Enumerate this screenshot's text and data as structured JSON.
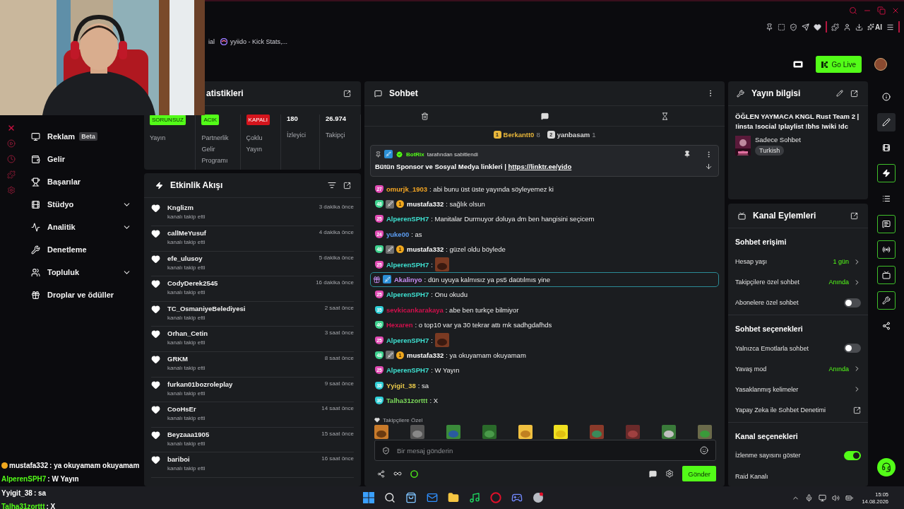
{
  "window_controls": [
    {
      "kind": "search"
    },
    {
      "kind": "minimize"
    },
    {
      "kind": "restore"
    },
    {
      "kind": "close"
    }
  ],
  "toolbar": [
    {
      "kind": "pin"
    },
    {
      "kind": "select"
    },
    {
      "kind": "shield"
    },
    {
      "kind": "send"
    },
    {
      "kind": "heart"
    },
    {
      "kind": "divider"
    },
    {
      "kind": "puzzle"
    },
    {
      "kind": "user"
    },
    {
      "kind": "download"
    },
    {
      "kind": "ai",
      "label": "AI"
    },
    {
      "kind": "menu"
    },
    {
      "kind": "divider"
    }
  ],
  "bookmarks": [
    {
      "kind": "text",
      "label": "ial"
    },
    {
      "kind": "site",
      "label": "yyiido - Kick Stats,..."
    }
  ],
  "header": {
    "go_live": "Go Live"
  },
  "sidebar": {
    "rail": [
      {
        "kind": "x"
      },
      {
        "kind": "play"
      },
      {
        "kind": "clock"
      },
      {
        "kind": "puzzle"
      },
      {
        "kind": "gear"
      }
    ],
    "items": [
      {
        "kind": "ad",
        "label": "Reklam",
        "badge": "Beta",
        "expandable": false
      },
      {
        "kind": "revenue",
        "label": "Gelir",
        "expandable": false
      },
      {
        "kind": "trophy",
        "label": "Başarılar",
        "expandable": false
      },
      {
        "kind": "studio",
        "label": "Stüdyo",
        "expandable": true
      },
      {
        "kind": "analytics",
        "label": "Analitik",
        "expandable": true
      },
      {
        "kind": "wrench",
        "label": "Denetleme",
        "expandable": false
      },
      {
        "kind": "community",
        "label": "Topluluk",
        "expandable": true
      },
      {
        "kind": "drops",
        "label": "Droplar ve ödüller",
        "expandable": false
      }
    ]
  },
  "stats": {
    "title": "atistikleri",
    "cells": [
      {
        "kind": "badge",
        "badge": "SORUNSUZ",
        "color": "#53fc18",
        "label": "Yayın"
      },
      {
        "kind": "badge",
        "badge": "ACIK",
        "color": "#53fc18",
        "label": "Partnerlik Gelir Programı"
      },
      {
        "kind": "badge",
        "badge": "KAPALI",
        "color": "#d4141c",
        "label": "Çoklu Yayın"
      },
      {
        "kind": "value",
        "value": "180",
        "label": "İzleyici"
      },
      {
        "kind": "value",
        "value": "26.974",
        "label": "Takipçi"
      }
    ]
  },
  "activity": {
    "title": "Etkinlik Akışı",
    "events": [
      {
        "user": "Knglizm",
        "action": "kanalı takip etti",
        "time": "3 dakika önce"
      },
      {
        "user": "callMeYusuf",
        "action": "kanalı takip etti",
        "time": "4 dakika önce"
      },
      {
        "user": "efe_ulusoy",
        "action": "kanalı takip etti",
        "time": "5 dakika önce"
      },
      {
        "user": "CodyDerek2545",
        "action": "kanalı takip etti",
        "time": "16 dakika önce"
      },
      {
        "user": "TC_OsmaniyeBelediyesi",
        "action": "kanalı takip etti",
        "time": "2 saat önce"
      },
      {
        "user": "Orhan_Cetin",
        "action": "kanalı takip etti",
        "time": "3 saat önce"
      },
      {
        "user": "GRKM",
        "action": "kanalı takip etti",
        "time": "8 saat önce"
      },
      {
        "user": "furkan01bozroleplay",
        "action": "kanalı takip etti",
        "time": "9 saat önce"
      },
      {
        "user": "CooHsEr",
        "action": "kanalı takip etti",
        "time": "14 saat önce"
      },
      {
        "user": "Beyzaaa1905",
        "action": "kanalı takip etti",
        "time": "15 saat önce"
      },
      {
        "user": "bariboi",
        "action": "kanalı takip etti",
        "time": "16 saat önce"
      }
    ]
  },
  "chat": {
    "title": "Sohbet",
    "leaders": [
      {
        "rank": "1",
        "name": "Berkantt0",
        "count": "8",
        "color": "#e8b63a"
      },
      {
        "rank": "2",
        "name": "yanbasam",
        "count": "1",
        "color": "#d8d8d8"
      }
    ],
    "pinned": {
      "by": "BotRix",
      "suffix": "tarafından sabitlendi",
      "text": "Bütün Sponsor ve Sosyal Medya linkleri |",
      "link": "https://linktr.ee/yido"
    },
    "messages": [
      {
        "badges": [
          {
            "kind": "sub",
            "label": "27",
            "color": "#e24bb4"
          }
        ],
        "user": "omurjk_1903",
        "color": "#f5a623",
        "text": ": abi bunu üst üste yayında söyleyemez ki",
        "emote": false,
        "highlighted": false
      },
      {
        "badges": [
          {
            "kind": "sub",
            "label": "48",
            "color": "#3fd28f"
          },
          {
            "kind": "mod",
            "color": "#6e6e6e"
          },
          {
            "kind": "count",
            "label": "1"
          }
        ],
        "user": "mustafa332",
        "color": "#ffffff",
        "text": ": sağlık olsun",
        "emote": false,
        "highlighted": false
      },
      {
        "badges": [
          {
            "kind": "sub",
            "label": "25",
            "color": "#e24bb4"
          }
        ],
        "user": "AlperenSPH7",
        "color": "#3ee0d0",
        "text": ": Manitalar Durmuyor doluya dm ben hangisini seçicem",
        "emote": false,
        "highlighted": false
      },
      {
        "badges": [
          {
            "kind": "sub",
            "label": "24",
            "color": "#e24bb4"
          }
        ],
        "user": "yuke00",
        "color": "#5b9cf0",
        "text": ": as",
        "emote": false,
        "highlighted": false
      },
      {
        "badges": [
          {
            "kind": "sub",
            "label": "48",
            "color": "#3fd28f"
          },
          {
            "kind": "mod",
            "color": "#6e6e6e"
          },
          {
            "kind": "count",
            "label": "1"
          }
        ],
        "user": "mustafa332",
        "color": "#ffffff",
        "text": ": güzel oldu böylede",
        "emote": false,
        "highlighted": false
      },
      {
        "badges": [
          {
            "kind": "sub",
            "label": "25",
            "color": "#e24bb4"
          }
        ],
        "user": "AlperenSPH7",
        "color": "#3ee0d0",
        "text": ":",
        "emote": true,
        "highlighted": false
      },
      {
        "badges": [
          {
            "kind": "gift"
          },
          {
            "kind": "mod",
            "color": "#2b8fd6"
          }
        ],
        "user": "Akalinyo",
        "color": "#c88ef5",
        "text": ": dün uyuya kalmısız ya ps5 daütılmıs yine",
        "emote": false,
        "highlighted": true
      },
      {
        "badges": [
          {
            "kind": "sub",
            "label": "25",
            "color": "#e24bb4"
          }
        ],
        "user": "AlperenSPH7",
        "color": "#3ee0d0",
        "text": ": Onu okudu",
        "emote": false,
        "highlighted": false
      },
      {
        "badges": [
          {
            "kind": "sub",
            "label": "35",
            "color": "#2fd0d8"
          }
        ],
        "user": "sevkicankarakaya",
        "color": "#d0104c",
        "text": ": abe ben turkçe bilmiyor",
        "emote": false,
        "highlighted": false
      },
      {
        "badges": [
          {
            "kind": "sub",
            "label": "40",
            "color": "#3fd28f"
          }
        ],
        "user": "Hexaren",
        "color": "#d0104c",
        "text": ": o top10 var ya 30 tekrar attı mk sadhgdafhds",
        "emote": false,
        "highlighted": false
      },
      {
        "badges": [
          {
            "kind": "sub",
            "label": "25",
            "color": "#e24bb4"
          }
        ],
        "user": "AlperenSPH7",
        "color": "#3ee0d0",
        "text": ":",
        "emote": true,
        "highlighted": false
      },
      {
        "badges": [
          {
            "kind": "sub",
            "label": "48",
            "color": "#3fd28f"
          },
          {
            "kind": "mod",
            "color": "#6e6e6e"
          },
          {
            "kind": "count",
            "label": "1"
          }
        ],
        "user": "mustafa332",
        "color": "#ffffff",
        "text": ": ya okuyamam okuyamam",
        "emote": false,
        "highlighted": false
      },
      {
        "badges": [
          {
            "kind": "sub",
            "label": "25",
            "color": "#e24bb4"
          }
        ],
        "user": "AlperenSPH7",
        "color": "#3ee0d0",
        "text": ": W Yayın",
        "emote": false,
        "highlighted": false
      },
      {
        "badges": [
          {
            "kind": "sub",
            "label": "38",
            "color": "#2fd0d8"
          }
        ],
        "user": "Yyigit_38",
        "color": "#e8c84a",
        "text": ": sa",
        "emote": false,
        "highlighted": false
      },
      {
        "badges": [
          {
            "kind": "sub",
            "label": "30",
            "color": "#2fd0d8"
          }
        ],
        "user": "Talha31zorttt",
        "color": "#7bd95a",
        "text": ": X",
        "emote": false,
        "highlighted": false
      }
    ],
    "emote_section": "Takipçilere Özel",
    "input": {
      "placeholder": "Bir mesaj gönderin"
    },
    "send": "Gönder"
  },
  "stream_info": {
    "title": "Yayın bilgisi",
    "stream_title": "ÖĞLEN YAYMACA KNGL Rust Team 2 | !insta !social !playlist !bhs !wiki !dc",
    "category": "Sadece Sohbet",
    "tag": "Turkish"
  },
  "channel_actions": {
    "title": "Kanal Eylemleri",
    "sections": [
      {
        "title": "Sohbet erişimi",
        "rows": [
          {
            "kind": "value",
            "label": "Hesap yaşı",
            "value": "1 gün"
          },
          {
            "kind": "value",
            "label": "Takipçilere özel sohbet",
            "value": "Anında"
          },
          {
            "kind": "toggle",
            "label": "Abonelere özel sohbet",
            "on": false
          }
        ]
      },
      {
        "title": "Sohbet seçenekleri",
        "rows": [
          {
            "kind": "toggle",
            "label": "Yalnızca Emotlarla sohbet",
            "on": false
          },
          {
            "kind": "value",
            "label": "Yavaş mod",
            "value": "Anında"
          },
          {
            "kind": "chevron",
            "label": "Yasaklanmış kelimeler"
          },
          {
            "kind": "external",
            "label": "Yapay Zeka ile Sohbet Denetimi"
          }
        ]
      },
      {
        "title": "Kanal seçenekleri",
        "rows": [
          {
            "kind": "toggle",
            "label": "İzlenme sayısını göster",
            "on": true
          },
          {
            "kind": "plain",
            "label": "Raid Kanalı"
          }
        ]
      }
    ]
  },
  "right_rail": [
    {
      "kind": "info",
      "selected": false,
      "outlined": false
    },
    {
      "kind": "pencil",
      "selected": true,
      "outlined": false
    },
    {
      "kind": "film",
      "selected": false,
      "outlined": false
    },
    {
      "kind": "bolt",
      "selected": false,
      "outlined": true
    },
    {
      "kind": "list",
      "selected": false,
      "outlined": false
    },
    {
      "kind": "chat",
      "selected": false,
      "outlined": true
    },
    {
      "kind": "broadcast",
      "selected": false,
      "outlined": true
    },
    {
      "kind": "channel",
      "selected": false,
      "outlined": true
    },
    {
      "kind": "wrench",
      "selected": false,
      "outlined": true
    },
    {
      "kind": "dots",
      "selected": false,
      "outlined": false
    }
  ],
  "overlay_chat": [
    {
      "user": "mustafa332",
      "text": " : ya okuyamam okuyamam",
      "color": "#ffffff",
      "badge": true
    },
    {
      "user": "AlperenSPH7",
      "text": " : W Yayın",
      "color": "#53fc18",
      "badge": false
    },
    {
      "user": "Yyigit_38",
      "text": " : sa",
      "color": "#ffffff",
      "badge": false
    },
    {
      "user": "Talha31zorttt",
      "text": " : X",
      "color": "#53fc18",
      "badge": false
    }
  ],
  "taskbar": {
    "apps": [
      {
        "kind": "windows"
      },
      {
        "kind": "search"
      },
      {
        "kind": "store"
      },
      {
        "kind": "mail"
      },
      {
        "kind": "folder"
      },
      {
        "kind": "music"
      },
      {
        "kind": "opera"
      },
      {
        "kind": "discord"
      },
      {
        "kind": "steam"
      }
    ],
    "time": "15:05",
    "date": "14.08.2026"
  }
}
